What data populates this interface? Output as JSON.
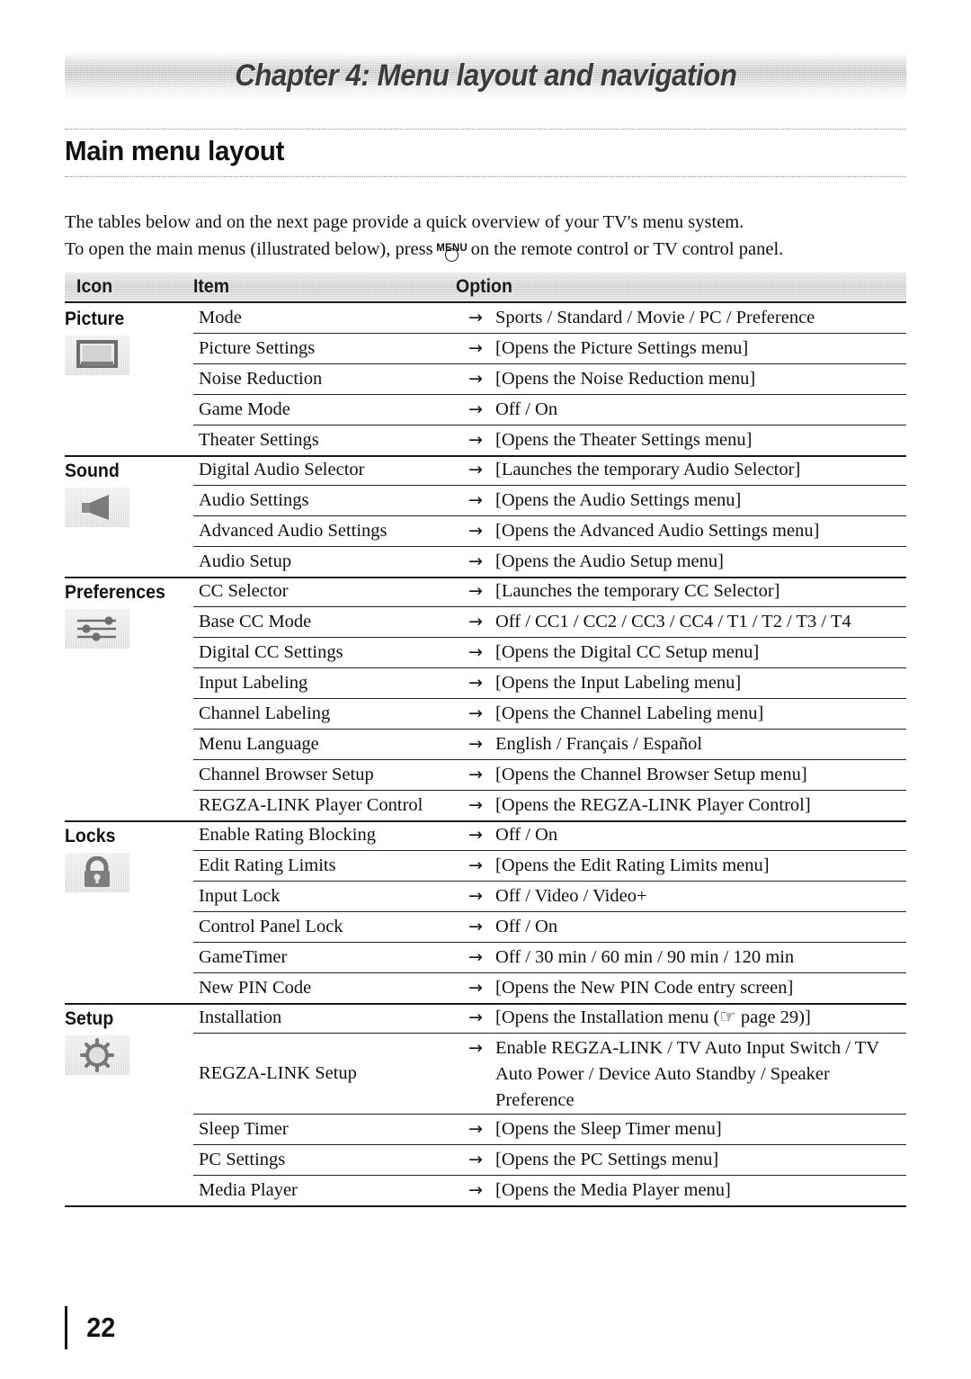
{
  "banner": {
    "title": "Chapter 4: Menu layout and navigation"
  },
  "page_title": "Main menu layout",
  "intro": {
    "line1": "The tables below and on the next page provide a quick overview of your TV's menu system.",
    "line2_before": "To open the main menus (illustrated below), press",
    "menu_key_label": "MENU",
    "line2_after": "on the remote control or TV control panel."
  },
  "table": {
    "headers": {
      "icon": "Icon",
      "item": "Item",
      "option": "Option"
    },
    "arrow": "→",
    "sections": [
      {
        "label": "Picture",
        "icon": "tv-screen-icon",
        "rows": [
          {
            "item": "Mode",
            "option": "Sports / Standard / Movie / PC / Preference"
          },
          {
            "item": "Picture Settings",
            "option": "[Opens the Picture Settings menu]"
          },
          {
            "item": "Noise Reduction",
            "option": "[Opens the Noise Reduction menu]"
          },
          {
            "item": "Game Mode",
            "option": "Off / On"
          },
          {
            "item": "Theater Settings",
            "option": "[Opens the Theater Settings menu]"
          }
        ]
      },
      {
        "label": "Sound",
        "icon": "speaker-icon",
        "rows": [
          {
            "item": "Digital Audio Selector",
            "option": "[Launches the temporary Audio Selector]"
          },
          {
            "item": "Audio Settings",
            "option": "[Opens the Audio Settings menu]"
          },
          {
            "item": "Advanced Audio Settings",
            "option": "[Opens the Advanced Audio Settings menu]"
          },
          {
            "item": "Audio Setup",
            "option": "[Opens the Audio Setup menu]"
          }
        ]
      },
      {
        "label": "Preferences",
        "icon": "sliders-icon",
        "rows": [
          {
            "item": "CC Selector",
            "option": "[Launches the temporary CC Selector]"
          },
          {
            "item": "Base CC Mode",
            "option": "Off / CC1 / CC2 / CC3 / CC4 / T1 / T2 / T3 / T4"
          },
          {
            "item": "Digital CC Settings",
            "option": "[Opens the Digital CC Setup menu]"
          },
          {
            "item": "Input Labeling",
            "option": "[Opens the Input Labeling menu]"
          },
          {
            "item": "Channel Labeling",
            "option": "[Opens the Channel Labeling menu]"
          },
          {
            "item": "Menu Language",
            "option": "English / Français / Español"
          },
          {
            "item": "Channel Browser Setup",
            "option": "[Opens the Channel Browser Setup menu]"
          },
          {
            "item": "REGZA-LINK Player Control",
            "option": "[Opens the REGZA-LINK Player Control]"
          }
        ]
      },
      {
        "label": "Locks",
        "icon": "padlock-icon",
        "rows": [
          {
            "item": "Enable Rating Blocking",
            "option": "Off / On"
          },
          {
            "item": "Edit Rating Limits",
            "option": "[Opens the Edit Rating Limits menu]"
          },
          {
            "item": "Input Lock",
            "option": "Off / Video / Video+"
          },
          {
            "item": "Control Panel Lock",
            "option": "Off / On"
          },
          {
            "item": "GameTimer",
            "option": "Off / 30 min / 60 min / 90 min / 120 min"
          },
          {
            "item": "New PIN Code",
            "option": "[Opens the New PIN Code entry screen]"
          }
        ]
      },
      {
        "label": "Setup",
        "icon": "sun-gear-icon",
        "rows": [
          {
            "item": "Installation",
            "option": "[Opens the Installation menu (☞ page 29)]"
          },
          {
            "item": "REGZA-LINK Setup",
            "option": "Enable REGZA-LINK / TV Auto Input Switch / TV Auto Power / Device Auto Standby / Speaker Preference",
            "tall": true
          },
          {
            "item": "Sleep Timer",
            "option": "[Opens the Sleep Timer menu]"
          },
          {
            "item": "PC Settings",
            "option": "[Opens the PC Settings menu]"
          },
          {
            "item": "Media Player",
            "option": "[Opens the Media Player menu]"
          }
        ]
      }
    ]
  },
  "footer": {
    "page_number": "22"
  }
}
